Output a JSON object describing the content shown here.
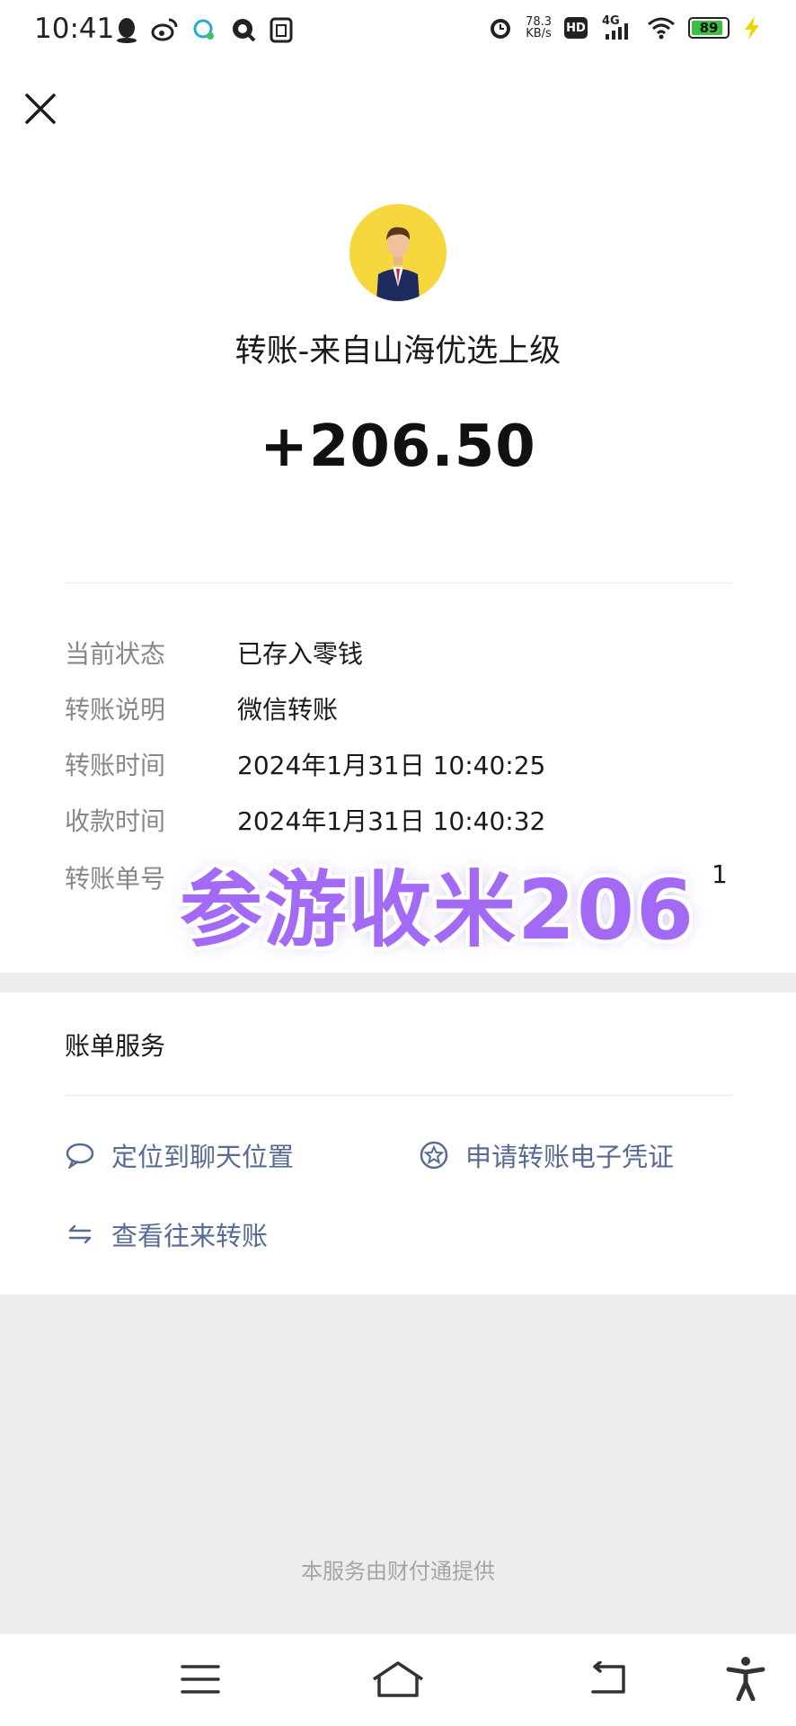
{
  "status_bar": {
    "time": "10:41",
    "speed_value": "78.3",
    "speed_unit": "KB/s",
    "hd": "HD",
    "network": "4G",
    "battery": "89",
    "battery_level": 0.89,
    "battery_color": "#39c043"
  },
  "header": {
    "close_icon": "close-icon"
  },
  "transfer": {
    "title": "转账-来自山海优选上级",
    "amount": "+206.50"
  },
  "details": {
    "rows": [
      {
        "label": "当前状态",
        "value": "已存入零钱"
      },
      {
        "label": "转账说明",
        "value": "微信转账"
      },
      {
        "label": "转账时间",
        "value": "2024年1月31日 10:40:25"
      },
      {
        "label": "收款时间",
        "value": "2024年1月31日 10:40:32"
      },
      {
        "label": "转账单号",
        "value": "1"
      }
    ]
  },
  "watermark": {
    "text": "参游收米206",
    "color": "#a36af5"
  },
  "services": {
    "title": "账单服务",
    "items": [
      {
        "label": "定位到聊天位置",
        "icon": "chat-bubble-icon"
      },
      {
        "label": "申请转账电子凭证",
        "icon": "star-badge-icon"
      },
      {
        "label": "查看往来转账",
        "icon": "transfer-arrows-icon"
      }
    ],
    "link_color": "#576b95"
  },
  "footer": {
    "note": "本服务由财付通提供"
  },
  "navbar": {
    "icons": [
      "menu-icon",
      "home-icon",
      "back-icon",
      "accessibility-icon"
    ]
  }
}
